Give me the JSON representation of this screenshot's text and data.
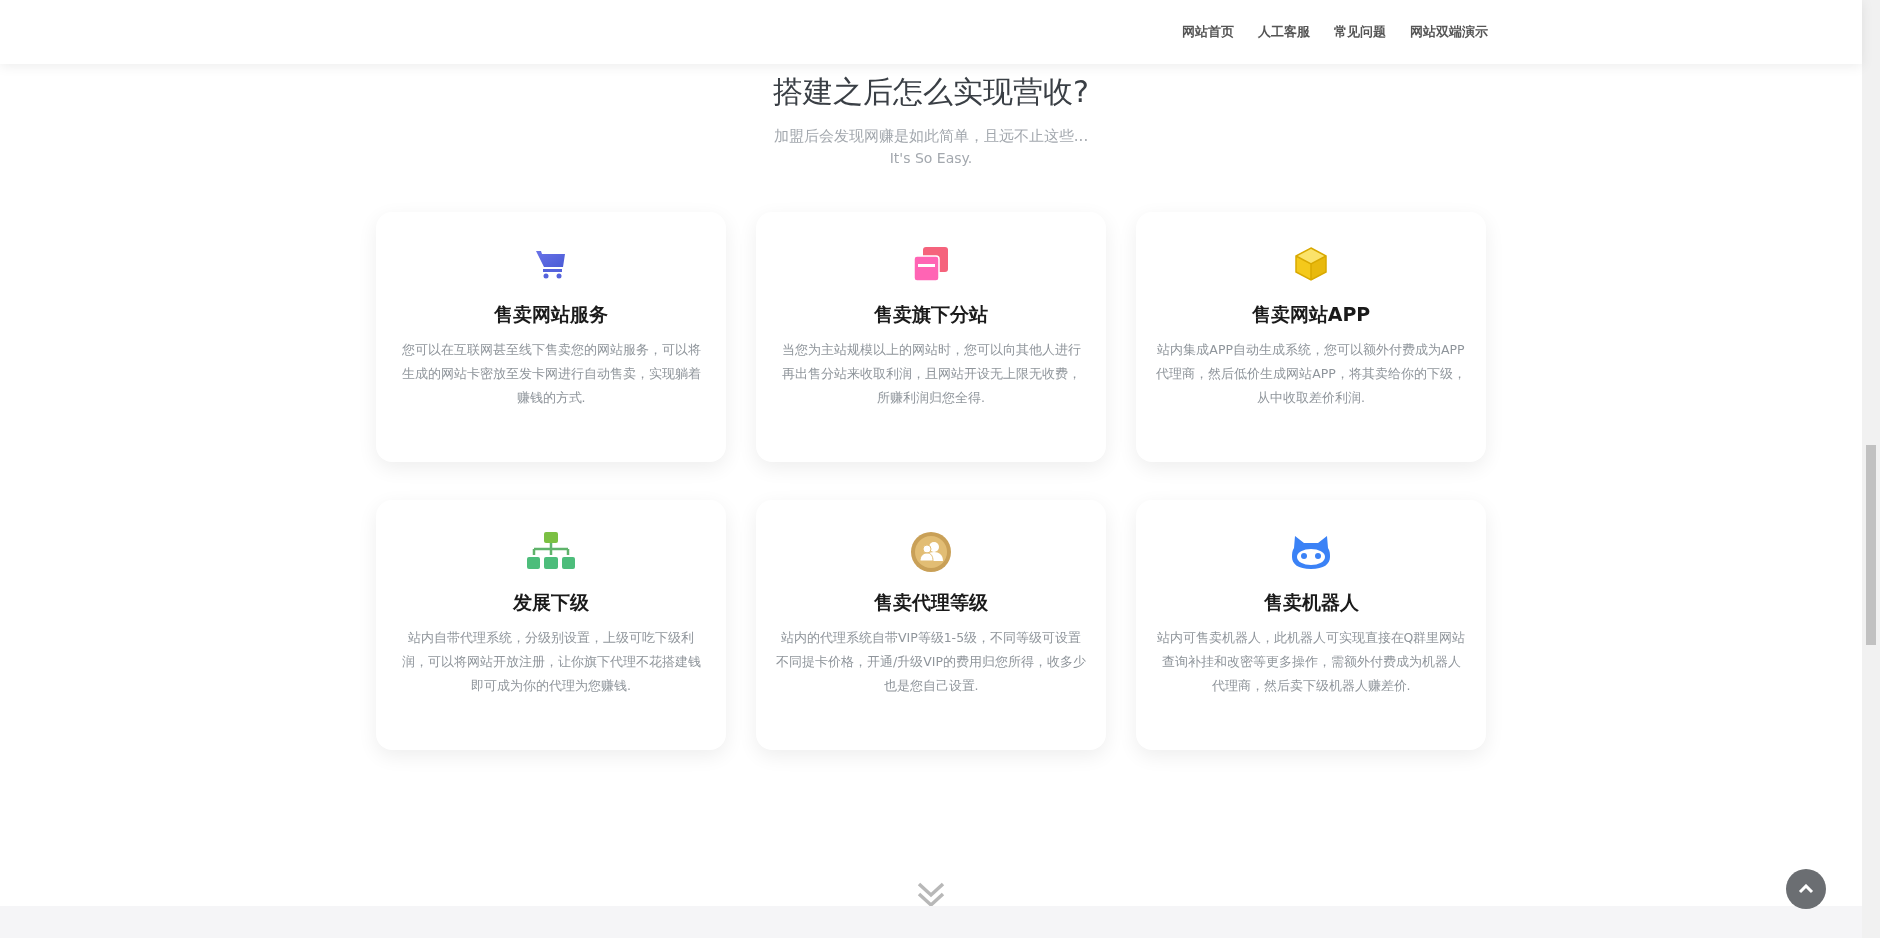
{
  "nav": [
    "网站首页",
    "人工客服",
    "常见问题",
    "网站双端演示"
  ],
  "section": {
    "title": "搭建之后怎么实现营收?",
    "subtitle": "加盟后会发现网赚是如此简单，且远不止这些...",
    "tagline": "It's So Easy."
  },
  "cards": [
    {
      "kind": "cart",
      "title": "售卖网站服务",
      "text": "您可以在互联网甚至线下售卖您的网站服务，可以将生成的网站卡密放至发卡网进行自动售卖，实现躺着赚钱的方式."
    },
    {
      "kind": "windows",
      "title": "售卖旗下分站",
      "text": "当您为主站规模以上的网站时，您可以向其他人进行再出售分站来收取利润，且网站开设无上限无收费，所赚利润归您全得."
    },
    {
      "kind": "cube",
      "title": "售卖网站APP",
      "text": "站内集成APP自动生成系统，您可以额外付费成为APP代理商，然后低价生成网站APP，将其卖给你的下级，从中收取差价利润."
    },
    {
      "kind": "tree",
      "title": "发展下级",
      "text": "站内自带代理系统，分级别设置，上级可吃下级利润，可以将网站开放注册，让你旗下代理不花搭建钱即可成为你的代理为您赚钱."
    },
    {
      "kind": "users",
      "title": "售卖代理等级",
      "text": "站内的代理系统自带VIP等级1-5级，不同等级可设置不同提卡价格，开通/升级VIP的费用归您所得，收多少也是您自己设置."
    },
    {
      "kind": "robot",
      "title": "售卖机器人",
      "text": "站内可售卖机器人，此机器人可实现直接在Q群里网站查询补挂和改密等更多操作，需额外付费成为机器人代理商，然后卖下级机器人赚差价."
    }
  ]
}
